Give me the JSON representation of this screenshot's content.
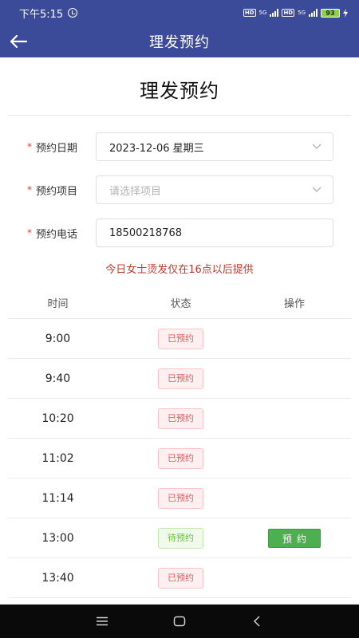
{
  "status_bar": {
    "time": "下午5:15",
    "hd1": "HD",
    "net1": "5G",
    "hd2": "HD",
    "net2": "5G",
    "battery": "93"
  },
  "header": {
    "title": "理发预约"
  },
  "page": {
    "title": "理发预约"
  },
  "form": {
    "date": {
      "label": "预约日期",
      "value": "2023-12-06 星期三"
    },
    "service": {
      "label": "预约项目",
      "placeholder": "请选择项目"
    },
    "phone": {
      "label": "预约电话",
      "value": "18500218768"
    }
  },
  "notice": "今日女士烫发仅在16点以后提供",
  "table": {
    "headers": {
      "time": "时间",
      "status": "状态",
      "action": "操作"
    },
    "rows": [
      {
        "time": "9:00",
        "status": "已预约",
        "available": false
      },
      {
        "time": "9:40",
        "status": "已预约",
        "available": false
      },
      {
        "time": "10:20",
        "status": "已预约",
        "available": false
      },
      {
        "time": "11:02",
        "status": "已预约",
        "available": false
      },
      {
        "time": "11:14",
        "status": "已预约",
        "available": false
      },
      {
        "time": "13:00",
        "status": "待预约",
        "available": true,
        "action": "预约"
      },
      {
        "time": "13:40",
        "status": "已预约",
        "available": false
      }
    ]
  },
  "colors": {
    "header_bg": "#3b4b9a",
    "booked": "#e05a5a",
    "available": "#67c23a",
    "book_button": "#4caf50",
    "notice": "#c0392b"
  },
  "icons": {
    "back": "arrow-left-icon",
    "alarm": "alarm-icon",
    "dropdown": "chevron-down-icon",
    "nav_menu": "menu-icon",
    "nav_home": "home-icon",
    "nav_back": "back-icon"
  }
}
